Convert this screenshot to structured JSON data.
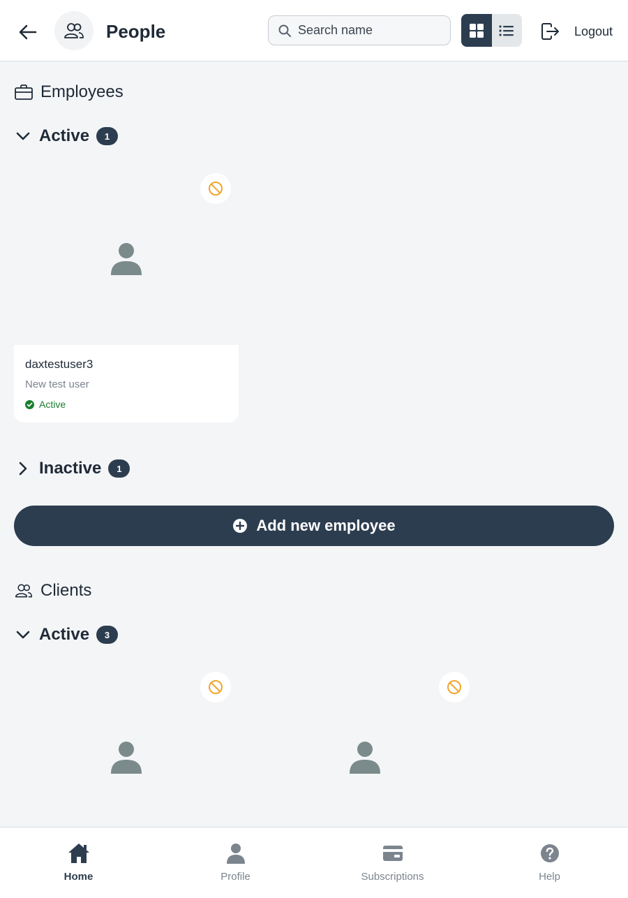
{
  "header": {
    "title": "People",
    "search_placeholder": "Search name",
    "logout_label": "Logout"
  },
  "employees": {
    "section_title": "Employees",
    "active": {
      "label": "Active",
      "count": "1",
      "cards": [
        {
          "name": "daxtestuser3",
          "description": "New test user",
          "status": "Active"
        }
      ]
    },
    "inactive": {
      "label": "Inactive",
      "count": "1"
    },
    "add_button_label": "Add new employee"
  },
  "clients": {
    "section_title": "Clients",
    "active": {
      "label": "Active",
      "count": "3"
    }
  },
  "bottom_nav": {
    "items": [
      {
        "label": "Home",
        "icon": "home-icon",
        "active": true
      },
      {
        "label": "Profile",
        "icon": "person-icon",
        "active": false
      },
      {
        "label": "Subscriptions",
        "icon": "credit-card-icon",
        "active": false
      },
      {
        "label": "Help",
        "icon": "help-icon",
        "active": false
      }
    ]
  },
  "colors": {
    "primary": "#2d3d50",
    "background": "#f3f5f7",
    "status_active": "#1a7f2e",
    "block_icon": "#f0a52a",
    "avatar_placeholder": "#7b8a8b"
  }
}
